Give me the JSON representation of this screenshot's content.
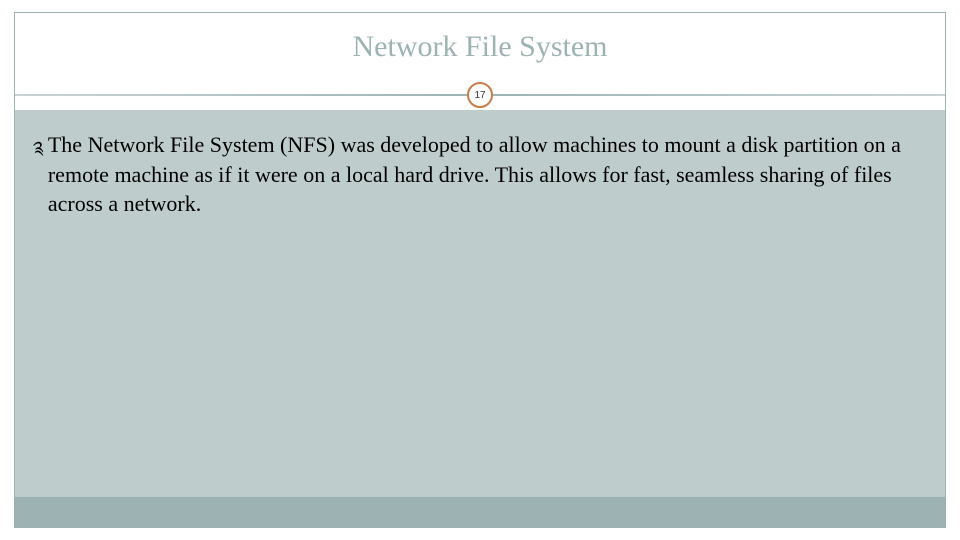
{
  "slide": {
    "title": "Network File System",
    "number": "17",
    "bullets": [
      {
        "text": "The Network File System (NFS) was developed to allow machines to mount a disk partition on a remote machine as if it were on a local hard drive. This allows for fast, seamless sharing of files across a network."
      }
    ]
  },
  "colors": {
    "accent": "#9db3b3",
    "badge_border": "#c97b4a",
    "content_bg": "#bfcccc"
  }
}
